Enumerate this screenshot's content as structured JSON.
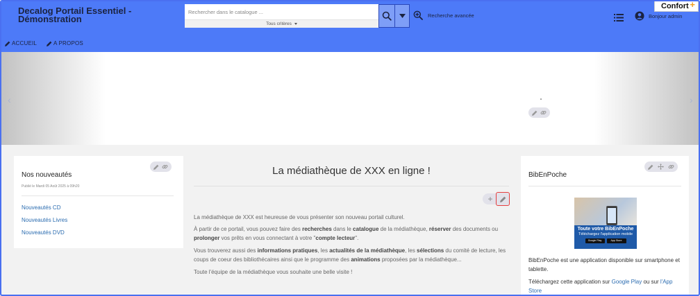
{
  "header": {
    "site_title": "Decalog Portail Essentiel - Démonstration",
    "search_placeholder": "Rechercher dans le catalogue ...",
    "criteria_label": "Tous critères",
    "advanced_search_label": "Recherche avancée",
    "user_label": "Bonjour admin",
    "confort_label": "Confort",
    "confort_plus": "+"
  },
  "nav": {
    "items": [
      {
        "label": "ACCUEIL"
      },
      {
        "label": "A PROPOS"
      }
    ]
  },
  "carousel": {
    "prev_arrow": "‹",
    "next_arrow": "›"
  },
  "left_box": {
    "title": "Nos nouveautés",
    "published": "Publié le Mardi 05 Août 2025 à 09h20",
    "links": [
      "Nouveautés CD",
      "Nouveautés Livres",
      "Nouveautés DVD"
    ]
  },
  "center": {
    "title": "La médiathèque de XXX en ligne !",
    "add_label": "+",
    "p1": "La médiathèque de XXX est heureuse de vous présenter son nouveau portail culturel.",
    "p2_a": "À partir de ce portail, vous pouvez faire des ",
    "p2_b": "recherches",
    "p2_c": " dans le ",
    "p2_d": "catalogue",
    "p2_e": " de la médiathèque, ",
    "p2_f": "réserver",
    "p2_g": " des documents ou ",
    "p2_h": "prolonger",
    "p2_i": " vos prêts en vous connectant à votre \"",
    "p2_j": "compte lecteur",
    "p2_k": "\".",
    "p3_a": "Vous trouverez aussi des ",
    "p3_b": "informations pratiques",
    "p3_c": ", les ",
    "p3_d": "actualités de la médiathèque",
    "p3_e": ", les ",
    "p3_f": "sélections",
    "p3_g": " du comité de lecture, les coups de coeur des bibliothécaires ainsi que le programme des ",
    "p3_h": "animations",
    "p3_i": " proposées par la médiathèque...",
    "p4": "Toute l'équipe de la médiathèque vous souhaite une belle visite !"
  },
  "right_box": {
    "title": "BibEnPoche",
    "ad_line1": "Toute votre BibEnPoche",
    "ad_line2": "Téléchargez l'application mobile",
    "ad_store1": "Google Play",
    "ad_store2": "App Store",
    "text1": "BibEnPoche est une application disponible sur smartphone et tablette.",
    "text2_a": "Téléchargez cette application sur ",
    "text2_b": "Google Play",
    "text2_c": " ou sur ",
    "text2_d": "l'App Store"
  },
  "icons": {
    "search": "search-icon",
    "dropdown": "caret-down-icon",
    "advanced": "zoom-plus-icon",
    "menu": "list-icon",
    "user": "user-circle-icon",
    "edit": "pencil-icon",
    "link": "link-icon",
    "move": "move-icon"
  },
  "colors": {
    "header_bg": "#4d7af8",
    "link": "#2b6cb0",
    "highlight": "#e53e3e",
    "ad_band": "#1f5aa8"
  }
}
